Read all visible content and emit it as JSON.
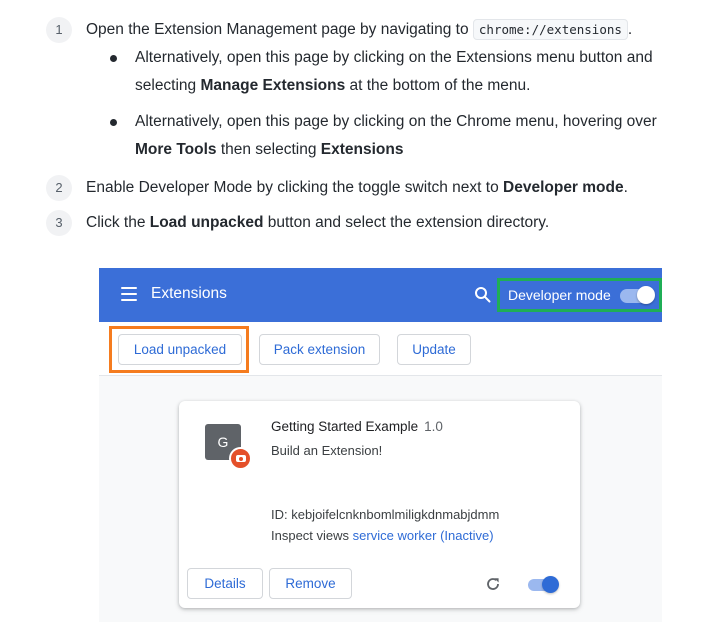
{
  "steps": [
    {
      "number": "1",
      "text": "Open the Extension Management page by navigating to ",
      "code": "chrome://extensions",
      "after": "."
    },
    {
      "number": "2",
      "text": "Enable Developer Mode by clicking the toggle switch next to ",
      "bold": "Developer mode",
      "after": "."
    },
    {
      "number": "3",
      "text": "Click the ",
      "bold": "Load unpacked",
      "after": " button and select the extension directory."
    }
  ],
  "bullets": [
    {
      "text_a": "Alternatively, open this page by clicking on the Extensions menu button and selecting ",
      "bold_a": "Manage Extensions",
      "text_b": " at the bottom of the menu."
    },
    {
      "text_a": "Alternatively, open this page by clicking on the Chrome menu, hovering over ",
      "bold_a": "More Tools",
      "text_b": " then selecting ",
      "bold_b": "Extensions"
    }
  ],
  "extensions_page": {
    "title": "Extensions",
    "developer_mode_label": "Developer mode",
    "developer_mode_on": true,
    "toolbar": {
      "load_unpacked": "Load unpacked",
      "pack_extension": "Pack extension",
      "update": "Update"
    },
    "card": {
      "icon_letter": "G",
      "name": "Getting Started Example",
      "version": "1.0",
      "description": "Build an Extension!",
      "id_line": "ID: kebjoifelcnknbomlmiligkdnmabjdmm",
      "inspect_prefix": "Inspect views ",
      "inspect_link": "service worker",
      "inspect_status": " (Inactive)",
      "details_label": "Details",
      "remove_label": "Remove",
      "enabled": true
    },
    "colors": {
      "header": "#3b6fd8",
      "accent": "#2e6bd6",
      "highlight_green": "#1fae56",
      "highlight_orange": "#f57c1f"
    }
  }
}
